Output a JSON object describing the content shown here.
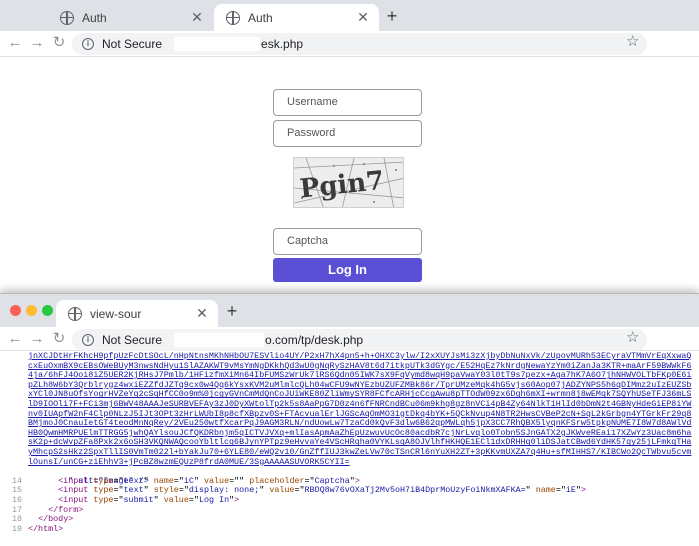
{
  "window1": {
    "tabs": [
      {
        "title": "Auth",
        "active": false
      },
      {
        "title": "Auth",
        "active": true
      }
    ],
    "address": {
      "security_label": "Not Secure",
      "url_visible": "esk.php"
    },
    "form": {
      "username_placeholder": "Username",
      "password_placeholder": "Password",
      "captcha_text": "Pgin7",
      "captcha_placeholder": "Captcha",
      "login_label": "Log In"
    }
  },
  "window2": {
    "tabs": [
      {
        "title": "view-sour",
        "active": true
      }
    ],
    "address": {
      "security_label": "Not Secure",
      "url_visible": "o.com/tp/desk.php"
    },
    "source": {
      "blob_line_numbers": [
        "",
        "",
        "",
        "",
        "",
        "",
        "",
        "",
        "",
        "",
        "",
        "",
        ""
      ],
      "blob_text": "jnXCJDtHrFKhcH9pfpUzFcDtSOcL/nHpNtnsMKhNHbOU7ESVlio4UY/P2xH7hX4pn5+h+OHXC3ylw/I2xXUYJsMi3zXjbyDbNuNxVk/zUpovMURh53ECyraVTMmVrEqXxwaQcxEuOxmBX9cEBsOWeBUyM3nwsNdHyu1SlAZAKWT9vMsYmNgDKkhQd3wU0gNqRySzHAV8t6d7itkpUTk3dGYgc/E52HqEz7kNrdgNewaYzYm0iZanJa3KTR+maArF59BWWkF64ja/6hFJ4Ooi8iZ5UER2KjRHsJ7Pmlb/1HFizfmXiMn64IbFUMSzWrUk7lRS6Qdn05IWK7sX9FqVymd8wqH9paVwaY03l0tT9s7pezx+Aga7hK7A6O7jhNHWVOLTbFKp0E6ipZLh8W6bY3Qrblrygz4wxiEZZfdJZTq9cx0w4Qq6kYsxKVM2uMlmlcQLh04wCFU9wNYEzbUZUFZMBk86r/TprUMzeMqk4hG5vjs60Aop07jADZYNPS5h6qDIMmz2uIzEUZSbxYCl0JN8uOfsYogrHVZeYq2cSqHfCC0o9m%0jcgyGVnCmMdQnCoJUiWKE80ZliWmySYR8FCfcARHjcCcgAwu8pTTOdW09zx6Dgh6mXI+wrmn8j8wEMqk7SQYhUSeTFJ36mLSlD9IOOli7F+FCi3mj6BWV48AAAJeSURBVEFAy3zJ0DyXWtolTp2k5s8AaPpG7D0z4n6fFNRCndBCu06m9khg8gz8nVCi4pB4Zy64NlkT1HlId0bDmN2t4GBNyHdeGiEP8iYWnv0IUApfW2nF4Clp0NLzJ5IJt3OPt3zHrLWUbI8p8cfXBpzv0S+FTAcvualErlJGScAqOmMO31gtDkq4bYK+5QCkNvup4N8TR2HwsCVBeP2cN+SqL2kGrbgn4YTGrkFr29q8BMjmoJ0CnauIetGT4teodMnNqRey/2VEu250wtfXcarPqJ9AGM3RLN/ndUowLw7TzaCd0kQvF3dlw6B62qpMWLqh5jpX3CC7RhQBX5lyqnKFSrw5tpkpNUME7I8W7d8AWlVdHB0QwmHMRPUElmTTRGG5jwhQAYlsouJCfQKDRbnjm5qICTVJVXq+mlIasApmAaZhEpUzwuvUcOc80acdbR7cjNrLvqlo0Tobn5SJnGATX2gJKWveREai17XZwYz3Uac8m6hasK2p+dcWvpZFa8Pxk2x6oSH3VKQNWAQcooYbltlcq6BJynYPTpz9eHvvaYe4VScHRqha0VYKLsqA8OJVlhfHKHQE1ECl1dxDRHHq0liDSJatCBwd6YdHK57qy25jLFmkqTHayMhcpS2sHkz2SpxTllIS0VmTm022l+bYakJu70+6YLE80/eWQ2v10/GnZffIUJ3kwZeLVw70cTSnCRl6nYuXH2ZT+3pKKvmUXZA7q4Hu+sfMIHHS7/KIBCWo2QcTWbvu5cvmlOunsI/unCG+ziEhhV3+jPcBZ8wzmEQUzP8frdA0MUE/3SgAAAAASUVORK5CYII=",
      "blob_suffix": "\" alt=\"Image\" />",
      "lines": [
        {
          "n": "14",
          "html": "      <span class=\"tag\">&lt;input</span> <span class=\"attr\">type</span>=\"<span class=\"val\">text</span>\" <span class=\"attr\">name</span>=\"<span class=\"val\">iC</span>\" <span class=\"attr\">value</span>=\"\" <span class=\"attr\">placeholder</span>=\"<span class=\"val\">Captcha</span>\"<span class=\"tag\">&gt;</span>"
        },
        {
          "n": "15",
          "html": "      <span class=\"tag\">&lt;input</span> <span class=\"attr\">type</span>=\"<span class=\"val\">text</span>\" <span class=\"attr\">style</span>=\"<span class=\"val\">display: none;</span>\" <span class=\"attr\">value</span>=\"<span class=\"val\">RBDQ8w76vOXaTj2Mv5oH7iB4DprMoUzyFoiNkmXAFKA=</span>\" <span class=\"attr\">name</span>=\"<span class=\"val\">iE</span>\"<span class=\"tag\">&gt;</span>"
        },
        {
          "n": "16",
          "html": "      <span class=\"tag\">&lt;input</span> <span class=\"attr\">type</span>=\"<span class=\"val\">submit</span>\" <span class=\"attr\">value</span>=\"<span class=\"val\">Log In</span>\"<span class=\"tag\">&gt;</span>"
        },
        {
          "n": "17",
          "html": "    <span class=\"tag\">&lt;/form&gt;</span>"
        },
        {
          "n": "18",
          "html": "  <span class=\"tag\">&lt;/body&gt;</span>"
        },
        {
          "n": "19",
          "html": "<span class=\"tag\">&lt;/html&gt;</span>"
        }
      ]
    }
  },
  "colors": {
    "accent": "#5b4fd6",
    "traffic_red": "#fe5f57",
    "traffic_yellow": "#febc2e",
    "traffic_green": "#28c840"
  },
  "icons": {
    "back": "back-arrow-icon",
    "forward": "forward-arrow-icon",
    "reload": "reload-icon",
    "info": "info-icon",
    "star": "bookmark-star-icon",
    "new_tab": "plus-icon",
    "tab_favicon": "globe-icon",
    "close": "close-icon"
  }
}
